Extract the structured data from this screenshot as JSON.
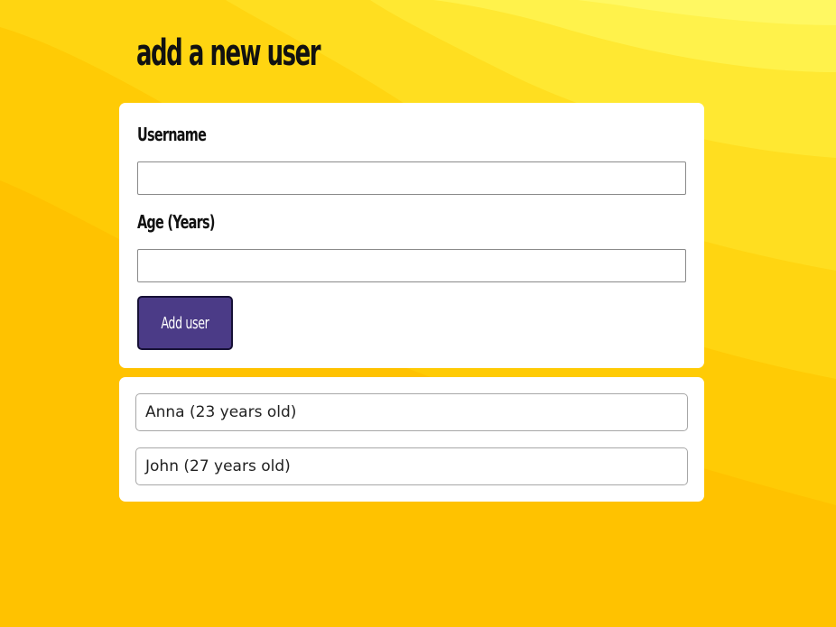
{
  "page": {
    "title": "add a new user"
  },
  "form": {
    "username_label": "Username",
    "username_value": "",
    "age_label": "Age (Years)",
    "age_value": "",
    "submit_label": "Add user"
  },
  "users": [
    {
      "text": "Anna (23 years old)"
    },
    {
      "text": "John (27 years old)"
    }
  ],
  "colors": {
    "background_top": "#fff55a",
    "background_bottom": "#ffbb00",
    "button": "#4b3b87",
    "button_border": "#171136",
    "card": "#ffffff"
  }
}
